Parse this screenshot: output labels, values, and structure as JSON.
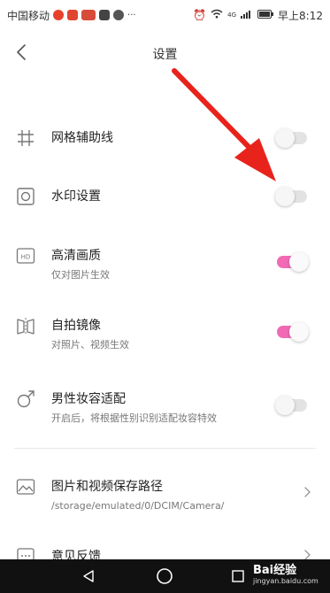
{
  "status_bar": {
    "carrier": "中国移动",
    "ellipsis": "···",
    "time": "早上8:12",
    "network": "4G"
  },
  "header": {
    "title": "设置"
  },
  "settings": [
    {
      "title": "网格辅助线",
      "subtitle": "",
      "icon": "grid-icon",
      "control": "toggle",
      "on": false
    },
    {
      "title": "水印设置",
      "subtitle": "",
      "icon": "watermark-icon",
      "control": "toggle",
      "on": false
    },
    {
      "title": "高清画质",
      "subtitle": "仅对图片生效",
      "icon": "hd-icon",
      "control": "toggle",
      "on": true
    },
    {
      "title": "自拍镜像",
      "subtitle": "对照片、视频生效",
      "icon": "mirror-icon",
      "control": "toggle",
      "on": true
    },
    {
      "title": "男性妆容适配",
      "subtitle": "开启后，将根据性别识别适配妆容特效",
      "icon": "male-icon",
      "control": "toggle",
      "on": false
    },
    {
      "title": "图片和视频保存路径",
      "subtitle": "/storage/emulated/0/DCIM/Camera/",
      "icon": "image-folder-icon",
      "control": "chevron"
    },
    {
      "title": "意见反馈",
      "subtitle": "",
      "icon": "feedback-icon",
      "control": "chevron"
    }
  ],
  "colors": {
    "toggle_on": "#f06ab6",
    "toggle_off": "#e3e3e3",
    "arrow": "#e8231c",
    "navbar": "#111111"
  },
  "watermark": {
    "brand": "Bai经验",
    "url": "jingyan.baidu.com"
  }
}
